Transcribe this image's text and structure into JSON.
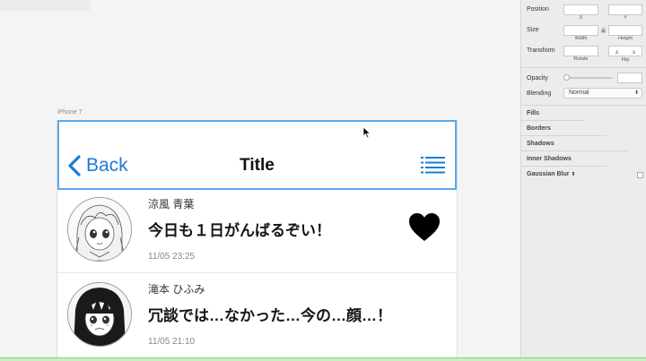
{
  "artboard": {
    "label": "iPhone 7"
  },
  "navbar": {
    "back_label": "Back",
    "title": "Title"
  },
  "messages": [
    {
      "name": "涼風 青葉",
      "text": "今日も１日がんばるぞい！",
      "time": "11/05 23:25",
      "liked": true
    },
    {
      "name": "滝本 ひふみ",
      "text": "冗談では…なかった…今の…顔…！",
      "time": "11/05 21:10",
      "liked": false
    }
  ],
  "inspector": {
    "position_label": "Position",
    "x_label": "X",
    "y_label": "Y",
    "size_label": "Size",
    "width_label": "Width",
    "height_label": "Height",
    "transform_label": "Transform",
    "rotate_label": "Rotate",
    "flip_label": "Flip",
    "opacity_label": "Opacity",
    "blending_label": "Blending",
    "blending_value": "Normal",
    "sections": [
      "Fills",
      "Borders",
      "Shadows",
      "Inner Shadows",
      "Gaussian Blur"
    ]
  },
  "colors": {
    "accent": "#1e7bd8",
    "selection": "#5aa8ee"
  }
}
